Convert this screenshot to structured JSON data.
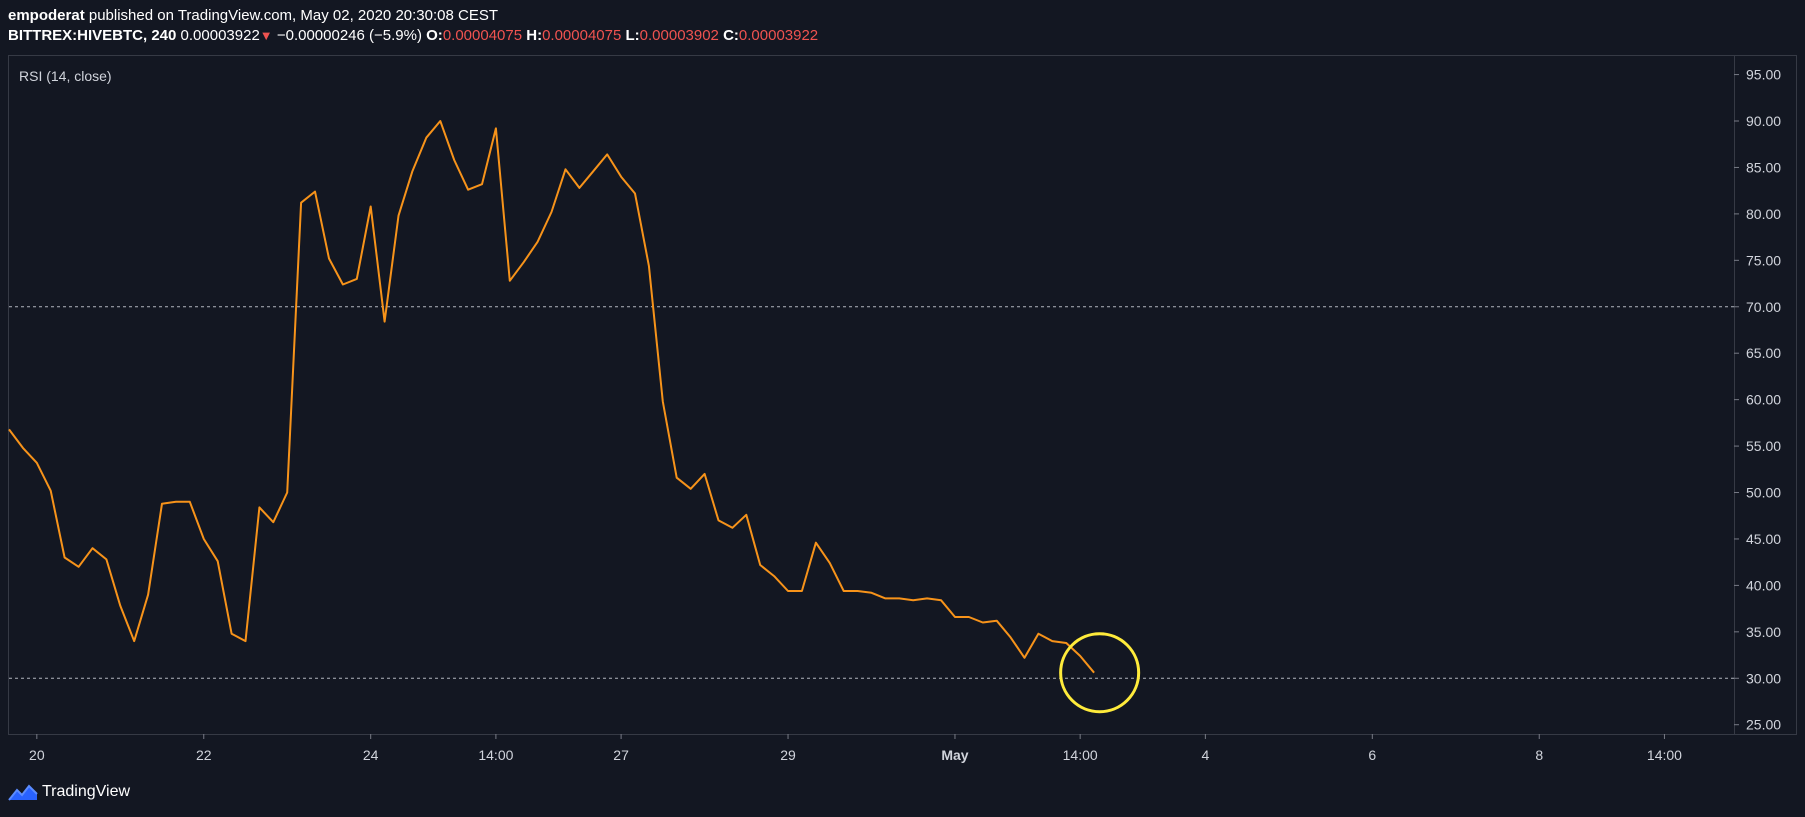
{
  "header": {
    "author": "empoderat",
    "published_text": "published on TradingView.com, May 02, 2020 20:30:08 CEST",
    "symbol": "BITTREX:HIVEBTC, 240",
    "last": "0.00003922",
    "change": "−0.00000246 (−5.9%)",
    "o_label": "O:",
    "o_value": "0.00004075",
    "h_label": "H:",
    "h_value": "0.00004075",
    "l_label": "L:",
    "l_value": "0.00003902",
    "c_label": "C:",
    "c_value": "0.00003922"
  },
  "footer": {
    "brand": "TradingView"
  },
  "colors": {
    "background": "#131722",
    "line": "#f7931a",
    "highlight": "#ffeb3b",
    "grid_border": "#363a45",
    "negative": "#ef5350"
  },
  "chart_data": {
    "type": "line",
    "title": "RSI (14, close)",
    "ylim": [
      24,
      97
    ],
    "yticks": [
      "95.00",
      "90.00",
      "85.00",
      "80.00",
      "75.00",
      "70.00",
      "65.00",
      "60.00",
      "55.00",
      "50.00",
      "45.00",
      "40.00",
      "35.00",
      "30.00",
      "25.00"
    ],
    "ytick_values": [
      95,
      90,
      85,
      80,
      75,
      70,
      65,
      60,
      55,
      50,
      45,
      40,
      35,
      30,
      25
    ],
    "xlim": [
      0,
      124
    ],
    "xticks": [
      {
        "label": "20",
        "x": 2,
        "bold": false
      },
      {
        "label": "22",
        "x": 14,
        "bold": false
      },
      {
        "label": "24",
        "x": 26,
        "bold": false
      },
      {
        "label": "14:00",
        "x": 35,
        "bold": false
      },
      {
        "label": "27",
        "x": 44,
        "bold": false
      },
      {
        "label": "29",
        "x": 56,
        "bold": false
      },
      {
        "label": "May",
        "x": 68,
        "bold": true
      },
      {
        "label": "14:00",
        "x": 77,
        "bold": false
      },
      {
        "label": "4",
        "x": 86,
        "bold": false
      },
      {
        "label": "6",
        "x": 98,
        "bold": false
      },
      {
        "label": "8",
        "x": 110,
        "bold": false
      },
      {
        "label": "14:00",
        "x": 119,
        "bold": false
      }
    ],
    "hlines": [
      70,
      30
    ],
    "grid": false,
    "series": [
      {
        "values": [
          56.8,
          54.8,
          53.2,
          50.2,
          43.0,
          42.0,
          44.0,
          42.8,
          37.8,
          34.0,
          39.0,
          48.8,
          49.0,
          49.0,
          45.0,
          42.6,
          34.8,
          34.0,
          48.4,
          46.8,
          50.0,
          81.2,
          82.4,
          75.2,
          72.4,
          73.0,
          80.8,
          68.4,
          79.8,
          84.6,
          88.2,
          90.0,
          85.8,
          82.6,
          83.2,
          89.2,
          72.8,
          74.8,
          77.0,
          80.2,
          84.8,
          82.8,
          84.6,
          86.4,
          84.0,
          82.2,
          74.4,
          59.8,
          51.6,
          50.4,
          52.0,
          47.0,
          46.2,
          47.6,
          42.2,
          41.0,
          39.4,
          39.4,
          44.6,
          42.4,
          39.4,
          39.4,
          39.2,
          38.6,
          38.6,
          38.4,
          38.6,
          38.4,
          36.6,
          36.6,
          36.0,
          36.2,
          34.4,
          32.2,
          34.8,
          34.0,
          33.8,
          32.4,
          30.6
        ]
      }
    ],
    "annotation": {
      "type": "circle",
      "x": 78.4,
      "y": 30.6,
      "color": "yellow"
    }
  }
}
